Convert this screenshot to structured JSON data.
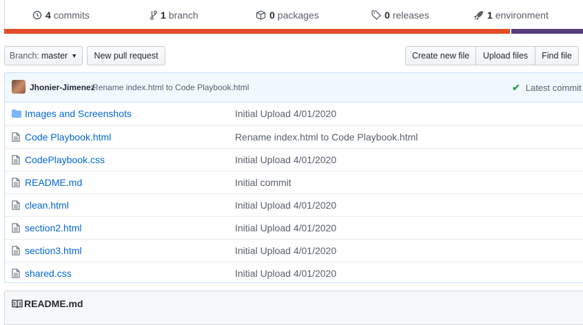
{
  "stats": {
    "commits": {
      "count": "4",
      "label": "commits"
    },
    "branches": {
      "count": "1",
      "label": "branch"
    },
    "packages": {
      "count": "0",
      "label": "packages"
    },
    "releases": {
      "count": "0",
      "label": "releases"
    },
    "environments": {
      "count": "1",
      "label": "environment"
    }
  },
  "language_bar": {
    "colors": [
      "#e34c26",
      "#563d7c"
    ],
    "fractions": [
      0.876,
      0.124
    ]
  },
  "toolbar": {
    "branch_prefix": "Branch:",
    "branch_name": "master",
    "new_pr": "New pull request",
    "create_file": "Create new file",
    "upload_files": "Upload files",
    "find_file": "Find file"
  },
  "commit": {
    "author": "Jhonier-Jimenez",
    "message": "Rename index.html to Code Playbook.html",
    "status": "Latest commit"
  },
  "files": [
    {
      "name": "Images and Screenshots",
      "type": "folder",
      "message": "Initial Upload 4/01/2020"
    },
    {
      "name": "Code Playbook.html",
      "type": "file",
      "message": "Rename index.html to Code Playbook.html"
    },
    {
      "name": "CodePlaybook.css",
      "type": "file",
      "message": "Initial Upload 4/01/2020"
    },
    {
      "name": "README.md",
      "type": "file",
      "message": "Initial commit"
    },
    {
      "name": "clean.html",
      "type": "file",
      "message": "Initial Upload 4/01/2020"
    },
    {
      "name": "section2.html",
      "type": "file",
      "message": "Initial Upload 4/01/2020"
    },
    {
      "name": "section3.html",
      "type": "file",
      "message": "Initial Upload 4/01/2020"
    },
    {
      "name": "shared.css",
      "type": "file",
      "message": "Initial Upload 4/01/2020"
    }
  ],
  "readme": {
    "title": "README.md"
  },
  "colors": {
    "link": "#0366d6",
    "muted": "#586069",
    "success": "#28a745"
  }
}
